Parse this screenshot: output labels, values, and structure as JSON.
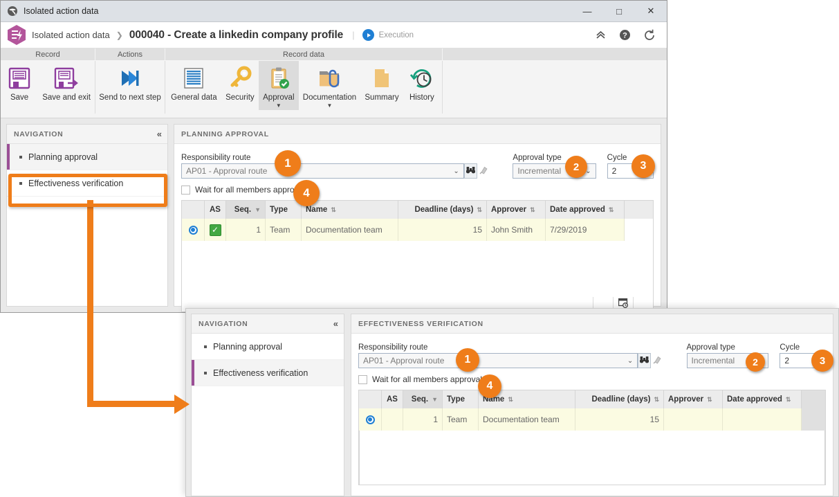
{
  "window": {
    "title": "Isolated action data",
    "app_icon": "globe-icon",
    "minimize": "—",
    "maximize": "□",
    "close": "✕"
  },
  "breadcrumb": {
    "module_icon": "action-hex-icon",
    "root": "Isolated action data",
    "separator": "❯",
    "record": "000040 - Create a linkedin company profile",
    "divider": "|",
    "status_label": "Execution",
    "collapse_icon": "chevron-up-double-icon",
    "help_icon": "help-icon",
    "refresh_icon": "refresh-icon"
  },
  "ribbon": {
    "groups": [
      {
        "title": "Record",
        "buttons": [
          {
            "label": "Save",
            "icon": "save-icon",
            "selected": false,
            "dropdown": false
          },
          {
            "label": "Save and exit",
            "icon": "save-and-exit-icon",
            "selected": false,
            "dropdown": false
          }
        ]
      },
      {
        "title": "Actions",
        "buttons": [
          {
            "label": "Send to next step",
            "icon": "next-step-icon",
            "selected": false,
            "dropdown": false
          }
        ]
      },
      {
        "title": "Record data",
        "buttons": [
          {
            "label": "General data",
            "icon": "general-data-icon",
            "selected": false,
            "dropdown": false
          },
          {
            "label": "Security",
            "icon": "key-icon",
            "selected": false,
            "dropdown": false
          },
          {
            "label": "Approval",
            "icon": "approval-clipboard-icon",
            "selected": true,
            "dropdown": true
          },
          {
            "label": "Documentation",
            "icon": "folder-clip-icon",
            "selected": false,
            "dropdown": true
          },
          {
            "label": "Summary",
            "icon": "summary-page-icon",
            "selected": false,
            "dropdown": false
          },
          {
            "label": "History",
            "icon": "history-clock-icon",
            "selected": false,
            "dropdown": false
          }
        ]
      }
    ]
  },
  "panel1": {
    "nav": {
      "header": "NAVIGATION",
      "collapse_icon": "collapse-left-icon",
      "items": [
        {
          "label": "Planning approval",
          "active": true
        },
        {
          "label": "Effectiveness verification",
          "active": false
        }
      ]
    },
    "header": "PLANNING APPROVAL",
    "form": {
      "route_label": "Responsibility route",
      "route_value": "AP01 - Approval route",
      "route_caret": "⌄",
      "search_icon": "binoculars-icon",
      "clear_icon": "eraser-icon",
      "approval_type_label": "Approval type",
      "approval_type_value": "Incremental",
      "approval_type_caret": "⌄",
      "cycle_label": "Cycle",
      "cycle_value": "2",
      "wait_label": "Wait for all members approval",
      "wait_checked": false
    },
    "grid": {
      "columns": [
        {
          "label": "",
          "sortable": false
        },
        {
          "label": "AS",
          "sortable": false
        },
        {
          "label": "Seq.",
          "sortable": true,
          "sorted": true
        },
        {
          "label": "Type",
          "sortable": false
        },
        {
          "label": "Name",
          "sortable": true
        },
        {
          "label": "Deadline (days)",
          "sortable": true
        },
        {
          "label": "Approver",
          "sortable": true
        },
        {
          "label": "Date approved",
          "sortable": true
        },
        {
          "label": "",
          "sortable": false
        }
      ],
      "rows": [
        {
          "selected": true,
          "as_checked": true,
          "seq": "1",
          "type": "Team",
          "name": "Documentation team",
          "deadline": "15",
          "approver": "John Smith",
          "date_approved": "7/29/2019"
        }
      ],
      "footer_icon": "window-search-icon"
    }
  },
  "panel2": {
    "nav": {
      "header": "NAVIGATION",
      "collapse_icon": "collapse-left-icon",
      "items": [
        {
          "label": "Planning approval",
          "active": false
        },
        {
          "label": "Effectiveness verification",
          "active": true
        }
      ]
    },
    "header": "EFFECTIVENESS VERIFICATION",
    "form": {
      "route_label": "Responsibility route",
      "route_value": "AP01 - Approval route",
      "route_caret": "⌄",
      "search_icon": "binoculars-icon",
      "clear_icon": "eraser-icon",
      "approval_type_label": "Approval type",
      "approval_type_value": "Incremental",
      "approval_type_caret": "⌄",
      "cycle_label": "Cycle",
      "cycle_value": "2",
      "wait_label": "Wait for all members approval",
      "wait_checked": false
    },
    "grid": {
      "columns": [
        {
          "label": "",
          "sortable": false
        },
        {
          "label": "AS",
          "sortable": false
        },
        {
          "label": "Seq.",
          "sortable": true,
          "sorted": true
        },
        {
          "label": "Type",
          "sortable": false
        },
        {
          "label": "Name",
          "sortable": true
        },
        {
          "label": "Deadline (days)",
          "sortable": true
        },
        {
          "label": "Approver",
          "sortable": true
        },
        {
          "label": "Date approved",
          "sortable": true
        },
        {
          "label": "",
          "sortable": false
        }
      ],
      "rows": [
        {
          "selected": true,
          "as_checked": false,
          "seq": "1",
          "type": "Team",
          "name": "Documentation team",
          "deadline": "15",
          "approver": "",
          "date_approved": ""
        }
      ]
    }
  },
  "annotations": {
    "accent_color": "#ef7d1a",
    "badges": [
      {
        "text": "1",
        "panel": "panel1"
      },
      {
        "text": "2",
        "panel": "panel1"
      },
      {
        "text": "3",
        "panel": "panel1"
      },
      {
        "text": "4",
        "panel": "panel1"
      },
      {
        "text": "1",
        "panel": "panel2"
      },
      {
        "text": "2",
        "panel": "panel2"
      },
      {
        "text": "3",
        "panel": "panel2"
      },
      {
        "text": "4",
        "panel": "panel2"
      }
    ],
    "callout_target": "Effectiveness verification"
  }
}
